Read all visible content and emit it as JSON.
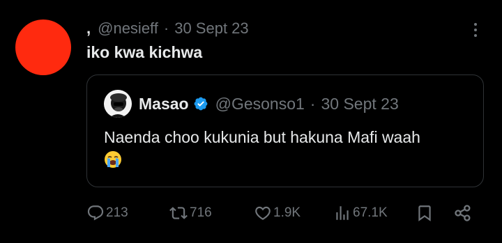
{
  "tweet": {
    "display_name": ",",
    "handle": "@nesieff",
    "separator": "·",
    "date": "30 Sept 23",
    "text": "iko kwa kichwa",
    "avatar_color": "#ff2a0f"
  },
  "quoted_tweet": {
    "display_name": "Masao",
    "verified": true,
    "handle": "@Gesonso1",
    "separator": "·",
    "date": "30 Sept 23",
    "text": "Naenda choo kukunia but hakuna Mafi waah",
    "emoji": "loudly-crying-face"
  },
  "actions": {
    "replies": "213",
    "reposts": "716",
    "likes": "1.9K",
    "views": "67.1K"
  },
  "colors": {
    "background": "#000000",
    "text_primary": "#e7e9ea",
    "text_secondary": "#71767b",
    "border": "#2f3336",
    "verified_blue": "#1d9bf0"
  }
}
